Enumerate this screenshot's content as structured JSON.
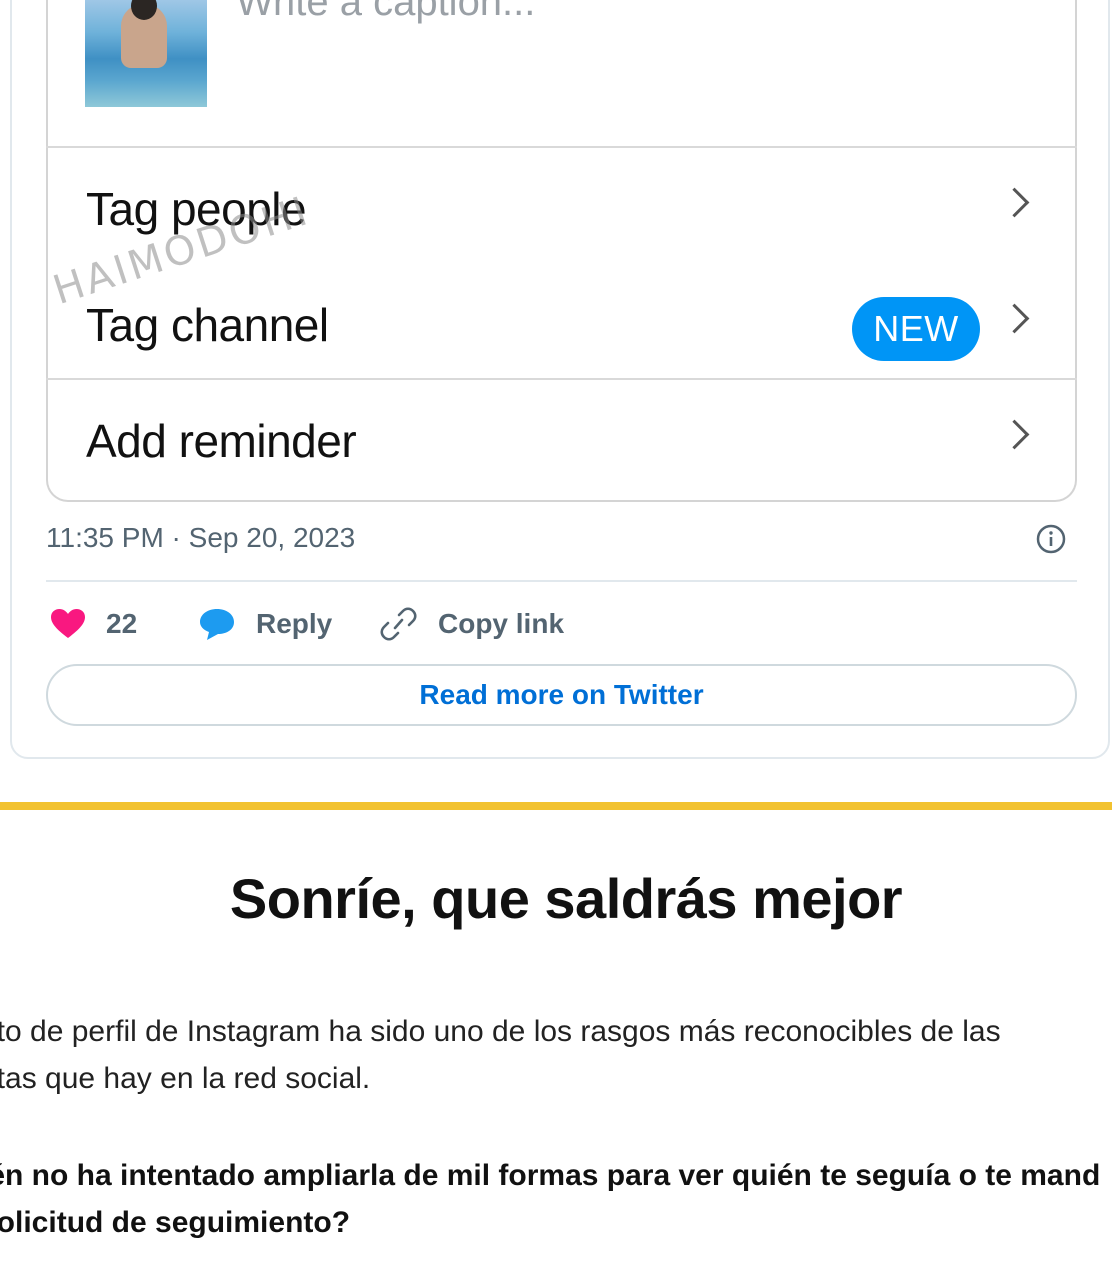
{
  "instagram": {
    "caption_placeholder": "Write a caption...",
    "menu": [
      {
        "label": "Tag people"
      },
      {
        "label": "Tag channel",
        "badge": "NEW"
      },
      {
        "label": "Add reminder"
      }
    ],
    "watermark": "HAIMODOHI"
  },
  "tweet": {
    "timestamp": "11:35 PM · Sep 20, 2023",
    "likes": "22",
    "reply_label": "Reply",
    "copy_link_label": "Copy link",
    "read_more_label": "Read more on Twitter"
  },
  "article": {
    "title": "Sonríe, que saldrás mejor",
    "paragraph_1_line_1": "oto de perfil de Instagram ha sido uno de los rasgos más reconocibles de las",
    "paragraph_1_line_2": "ntas que hay en la red social.",
    "paragraph_2_line_1": "ién no ha intentado ampliarla de mil formas para ver quién te seguía o te mand",
    "paragraph_2_line_2": " solicitud de seguimiento?"
  },
  "colors": {
    "accent_blue": "#0095f6",
    "twitter_link": "#006fd6",
    "heart": "#f91880",
    "reply_bubble": "#1d9bf0",
    "divider_yellow": "#f2c230"
  },
  "icons": [
    "chevron-right-icon",
    "info-icon",
    "heart-icon",
    "reply-bubble-icon",
    "link-icon"
  ]
}
